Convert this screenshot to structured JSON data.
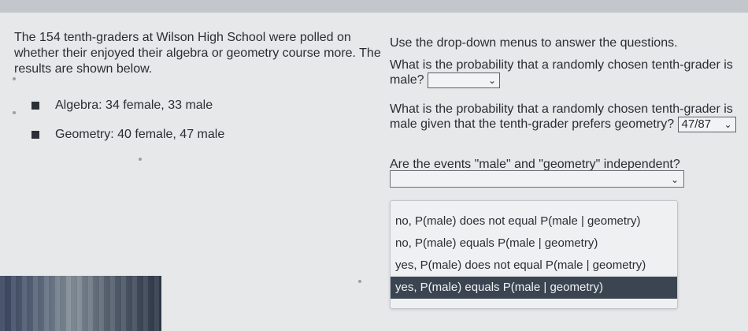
{
  "left": {
    "question": "The 154 tenth-graders at Wilson High School were polled on whether their enjoyed their algebra or geometry course more. The results are shown below.",
    "items": [
      "Algebra: 34 female, 33 male",
      "Geometry: 40 female, 47 male"
    ]
  },
  "right": {
    "instructions": "Use the drop-down menus to answer the questions.",
    "q1": "What is the probability that a randomly chosen tenth-grader is male?",
    "q1_value": "",
    "q2": "What is the probability that a randomly chosen tenth-grader is male given that the tenth-grader prefers geometry?",
    "q2_value": "47/87",
    "q3": "Are the events \"male\" and \"geometry\" independent?",
    "q3_value": "",
    "options": [
      "no, P(male) does not equal P(male | geometry)",
      "no, P(male) equals P(male | geometry)",
      "yes, P(male) does not equal P(male | geometry)",
      "yes, P(male) equals P(male | geometry)"
    ]
  },
  "icons": {
    "dropdown": "chevron-down-icon",
    "bullet": "square-bullet-icon"
  }
}
